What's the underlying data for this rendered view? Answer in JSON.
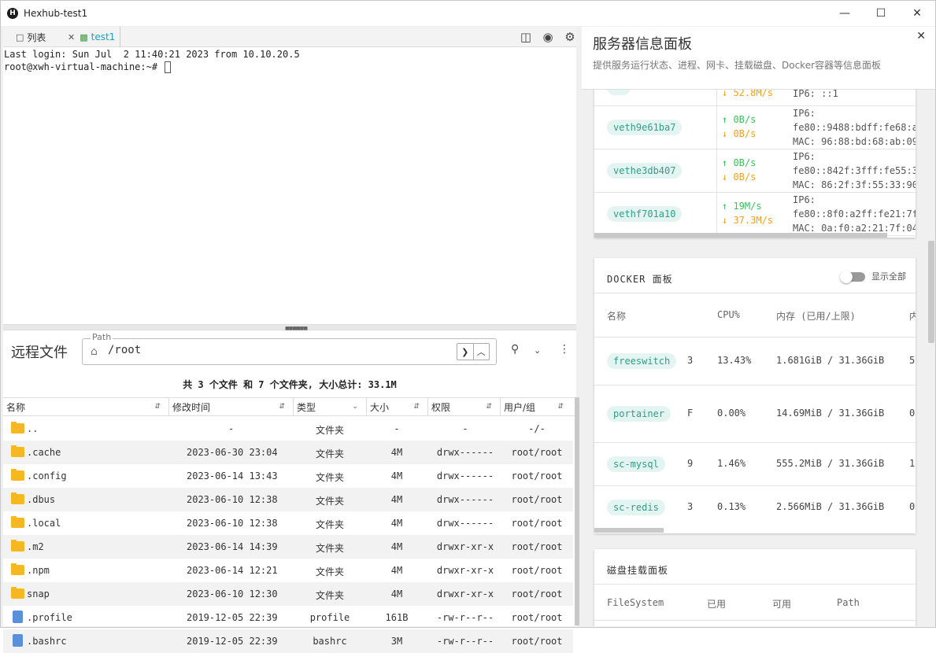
{
  "window": {
    "title": "Hexhub-test1",
    "logo": "H",
    "minimize": "—",
    "maximize": "☐",
    "close": "✕"
  },
  "tabs": [
    {
      "label": "列表",
      "icon": "window-icon"
    },
    {
      "label": "test1",
      "icon": "terminal-icon",
      "close": "✕"
    }
  ],
  "terminal": {
    "lines": [
      "Last login: Sun Jul  2 11:40:21 2023 from 10.10.20.5",
      "root@xwh-virtual-machine:~# "
    ]
  },
  "files": {
    "title": "远程文件",
    "path_legend": "Path",
    "path": "/root",
    "summary": "共 3 个文件 和 7 个文件夹, 大小总计: 33.1M",
    "columns": [
      "名称",
      "修改时间",
      "类型",
      "大小",
      "权限",
      "用户/组"
    ],
    "rows": [
      {
        "name": "..",
        "mtime": "-",
        "type": "文件夹",
        "size": "-",
        "perm": "-",
        "owner": "-/-",
        "kind": "folder"
      },
      {
        "name": ".cache",
        "mtime": "2023-06-30 23:04",
        "type": "文件夹",
        "size": "4M",
        "perm": "drwx------",
        "owner": "root/root",
        "kind": "folder"
      },
      {
        "name": ".config",
        "mtime": "2023-06-14 13:43",
        "type": "文件夹",
        "size": "4M",
        "perm": "drwx------",
        "owner": "root/root",
        "kind": "folder"
      },
      {
        "name": ".dbus",
        "mtime": "2023-06-10 12:38",
        "type": "文件夹",
        "size": "4M",
        "perm": "drwx------",
        "owner": "root/root",
        "kind": "folder"
      },
      {
        "name": ".local",
        "mtime": "2023-06-10 12:38",
        "type": "文件夹",
        "size": "4M",
        "perm": "drwx------",
        "owner": "root/root",
        "kind": "folder"
      },
      {
        "name": ".m2",
        "mtime": "2023-06-14 14:39",
        "type": "文件夹",
        "size": "4M",
        "perm": "drwxr-xr-x",
        "owner": "root/root",
        "kind": "folder"
      },
      {
        "name": ".npm",
        "mtime": "2023-06-14 12:21",
        "type": "文件夹",
        "size": "4M",
        "perm": "drwxr-xr-x",
        "owner": "root/root",
        "kind": "folder"
      },
      {
        "name": "snap",
        "mtime": "2023-06-10 12:30",
        "type": "文件夹",
        "size": "4M",
        "perm": "drwxr-xr-x",
        "owner": "root/root",
        "kind": "folder"
      },
      {
        "name": ".profile",
        "mtime": "2019-12-05 22:39",
        "type": "profile",
        "size": "161B",
        "perm": "-rw-r--r--",
        "owner": "root/root",
        "kind": "file"
      },
      {
        "name": ".bashrc",
        "mtime": "2019-12-05 22:39",
        "type": "bashrc",
        "size": "3M",
        "perm": "-rw-r--r--",
        "owner": "root/root",
        "kind": "file"
      }
    ]
  },
  "panel": {
    "title": "服务器信息面板",
    "subtitle": "提供服务运行状态、进程、网卡、挂载磁盘、Docker容器等信息面板",
    "close": "✕"
  },
  "network": {
    "partial": {
      "down": "↓ 52.8M/s",
      "ip6": "IP6: ::1"
    },
    "rows": [
      {
        "name": "veth9e61ba7",
        "up": "↑ 0B/s",
        "down": "↓ 0B/s",
        "ip6_label": "IP6:",
        "ip6": "fe80::9488:bdff:fe68:a",
        "mac": "MAC: 96:88:bd:68:ab:09"
      },
      {
        "name": "vethe3db407",
        "up": "↑ 0B/s",
        "down": "↓ 0B/s",
        "ip6_label": "IP6:",
        "ip6": "fe80::842f:3fff:fe55:3",
        "mac": "MAC: 86:2f:3f:55:33:90"
      },
      {
        "name": "vethf701a10",
        "up": "↑ 19M/s",
        "down": "↓ 37.3M/s",
        "ip6_label": "IP6:",
        "ip6": "fe80::8f0:a2ff:fe21:7f",
        "mac": "MAC: 0a:f0:a2:21:7f:04"
      }
    ]
  },
  "docker": {
    "title": "DOCKER 面板",
    "toggle_label": "显示全部",
    "columns": [
      "名称",
      "CPU%",
      "内存 (已用/上限)",
      "内"
    ],
    "rows": [
      {
        "name": "freeswitch",
        "cut": "3",
        "cpu": "13.43%",
        "mem": "1.681GiB / 31.36GiB",
        "next": "5"
      },
      {
        "name": "portainer",
        "cut": "F",
        "cpu": "0.00%",
        "mem": "14.69MiB / 31.36GiB",
        "next": "0"
      },
      {
        "name": "sc-mysql",
        "cut": "9",
        "cpu": "1.46%",
        "mem": "555.2MiB / 31.36GiB",
        "next": "1"
      },
      {
        "name": "sc-redis",
        "cut": "3",
        "cpu": "0.13%",
        "mem": "2.566MiB / 31.36GiB",
        "next": "0"
      }
    ]
  },
  "disk": {
    "title": "磁盘挂载面板",
    "columns": [
      "FileSystem",
      "已用",
      "可用",
      "Path"
    ]
  }
}
